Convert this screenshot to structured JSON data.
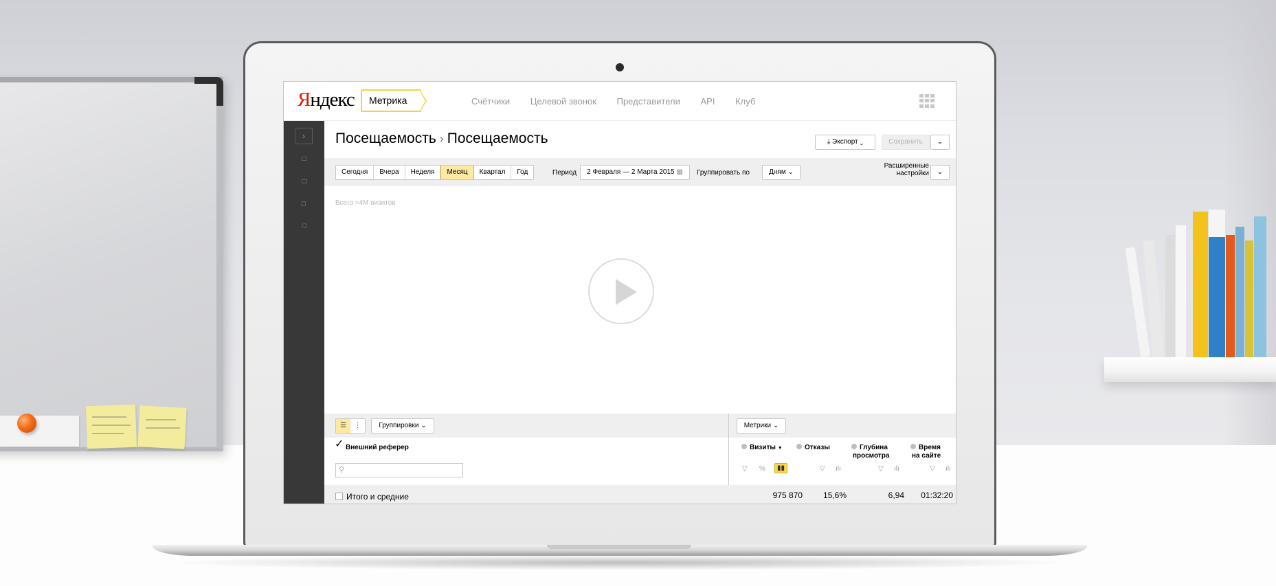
{
  "brand": {
    "logo_text_first": "Я",
    "logo_text_rest": "ндекс",
    "product": "Метрика"
  },
  "topnav": [
    "Счётчики",
    "Целевой звонок",
    "Представители",
    "API",
    "Клуб"
  ],
  "header": {
    "title_part1": "Посещаемость",
    "title_sep": "›",
    "title_part2": "Посещаемость",
    "export_label": "Экспорт",
    "save_label": "Сохранить"
  },
  "period_toolbar": {
    "presets": [
      "Сегодня",
      "Вчера",
      "Неделя",
      "Месяц",
      "Квартал",
      "Год"
    ],
    "active_preset": "Месяц",
    "period_label": "Период",
    "period_value": "2 Февраля — 2 Марта 2015",
    "group_by_label": "Группировать по",
    "group_by_value": "Дням",
    "advanced_label_line1": "Расширенные",
    "advanced_label_line2": "настройки"
  },
  "chart": {
    "total_label": "Всего ≈4М визитов"
  },
  "table": {
    "groupings_label": "Группировки",
    "metrics_label": "Метрики",
    "dimension_header": "Внешний реферер",
    "search_placeholder": "",
    "metrics": [
      {
        "name": "Визиты",
        "sort": "▼"
      },
      {
        "name": "Отказы"
      },
      {
        "name_line1": "Глубина",
        "name_line2": "просмотра"
      },
      {
        "name_line1": "Время",
        "name_line2": "на сайте"
      }
    ],
    "totals_label": "Итого и средние",
    "totals": [
      "975 870",
      "15,6%",
      "6,94",
      "01:32:20"
    ]
  },
  "colors": {
    "accent_yellow": "#f8d23c",
    "active_segment": "#fde9a2",
    "sidebar_bg": "#383838",
    "logo_red": "#e61400"
  }
}
